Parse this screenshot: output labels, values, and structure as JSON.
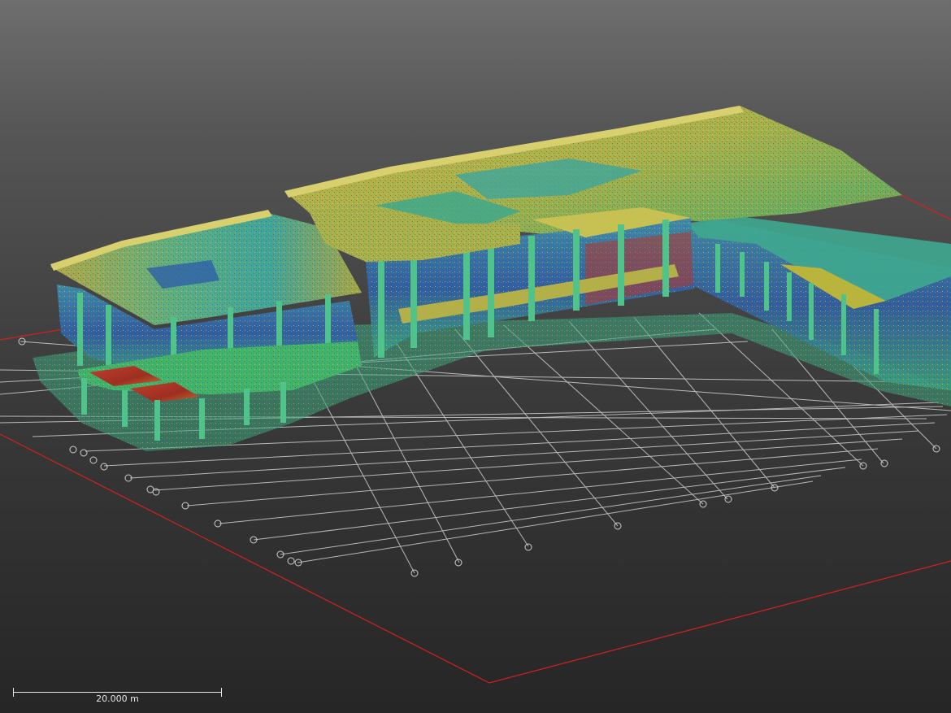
{
  "viewer": {
    "scale_bar": {
      "label": "20.000 m"
    }
  },
  "colors": {
    "background_top": "#6e6e6e",
    "background_bottom": "#262626",
    "bounding_box": "#d42020",
    "grid": "#cfcfcf",
    "cloud_yellow": "#b9b43c",
    "cloud_green": "#3fb56b",
    "cloud_teal": "#2f9f9a",
    "cloud_blue": "#2e5fa8",
    "cloud_red": "#b5362a",
    "cloud_orange": "#c9782b"
  }
}
